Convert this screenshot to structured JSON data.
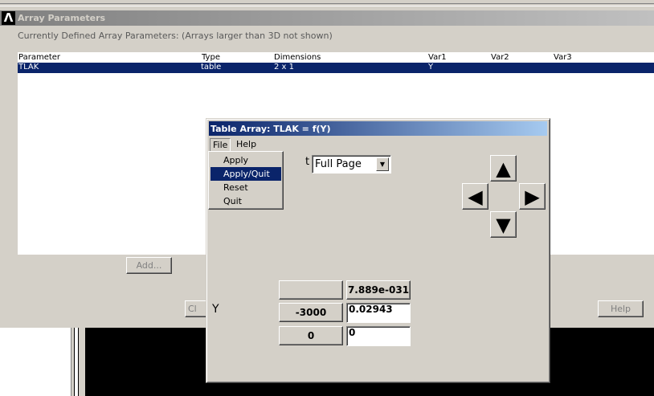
{
  "array_window": {
    "title": "Array Parameters",
    "subtitle": "Currently Defined Array Parameters:  (Arrays larger than 3D not shown)",
    "columns": [
      "Parameter",
      "Type",
      "Dimensions",
      "Var1",
      "Var2",
      "Var3"
    ],
    "rows": [
      {
        "parameter": "TLAK",
        "type": "table",
        "dimensions": "2 x 1",
        "var1": "Y",
        "var2": "",
        "var3": ""
      }
    ],
    "add_label": "Add...",
    "close_label_partial": "Cl",
    "help_label": "Help"
  },
  "table_dialog": {
    "title": "Table Array: TLAK = f(Y)",
    "menu": {
      "file": "File",
      "help": "Help"
    },
    "file_menu_items": [
      "Apply",
      "Apply/Quit",
      "Reset",
      "Quit"
    ],
    "file_menu_selected": "Apply/Quit",
    "partial_label": "t",
    "page_select": {
      "value": "Full Page"
    },
    "nav_icons": {
      "up": "arrow-up-icon",
      "down": "arrow-down-icon",
      "left": "arrow-left-icon",
      "right": "arrow-right-icon"
    },
    "var_label": "Y",
    "header_value": "7.889e-031",
    "rows": [
      {
        "index": "-3000",
        "value": "0.02943"
      },
      {
        "index": "0",
        "value": "0"
      }
    ]
  }
}
